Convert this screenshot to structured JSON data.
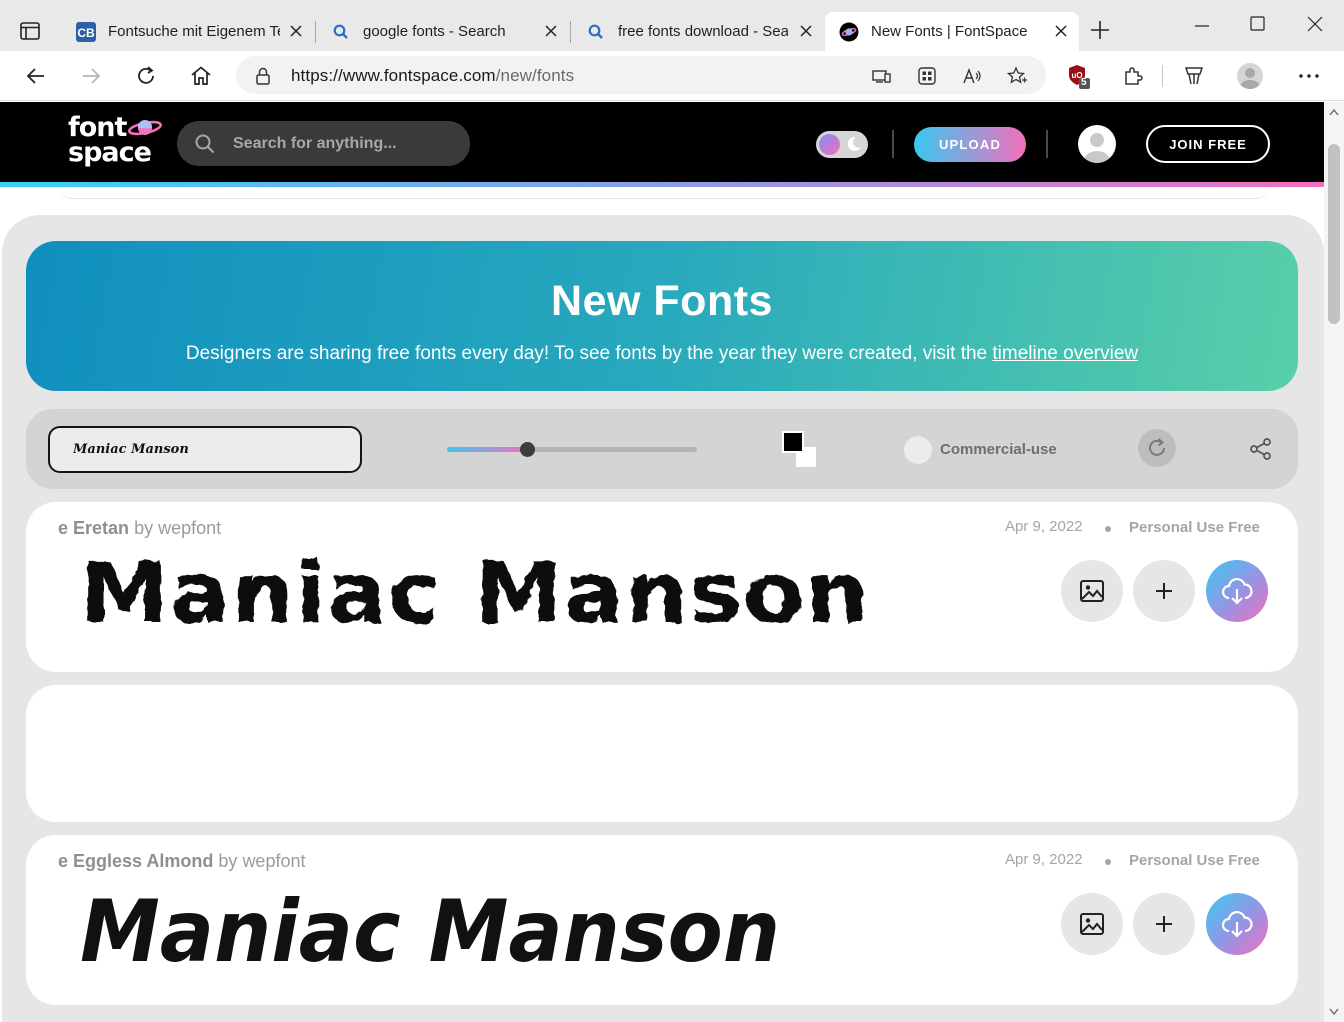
{
  "browser": {
    "tabs": [
      {
        "title": "Fontsuche mit Eigenem Te",
        "icon": "cb-favicon-icon",
        "active": false
      },
      {
        "title": "google fonts - Search",
        "icon": "search-favicon-icon",
        "active": false
      },
      {
        "title": "free fonts download - Sea",
        "icon": "search-favicon-icon",
        "active": false
      },
      {
        "title": "New Fonts | FontSpace",
        "icon": "fontspace-favicon-icon",
        "active": true
      }
    ],
    "url": {
      "domain": "https://www.fontspace.com",
      "path": "/new/fonts"
    },
    "extension_badge": "5"
  },
  "site": {
    "logo_line1": "font",
    "logo_line2": "space",
    "search_placeholder": "Search for anything...",
    "upload_label": "UPLOAD",
    "join_label": "JOIN FREE"
  },
  "hero": {
    "title": "New Fonts",
    "subtitle": "Designers are sharing free fonts every day! To see fonts by the year they were created, visit the",
    "link_text": "timeline overview"
  },
  "toolbar": {
    "preview_text": "Maniac Manson",
    "size_level": 0.32,
    "foreground_color": "#000000",
    "background_color": "#ffffff",
    "commercial_label": "Commercial-use"
  },
  "fonts": [
    {
      "prefix": "e",
      "name": "Eretan",
      "by": "by",
      "author": "wepfont",
      "date": "Apr 9, 2022",
      "license": "Personal Use Free",
      "preview": "Maniac Manson"
    },
    {
      "prefix": "e",
      "name": "Eggless Almond",
      "by": "by",
      "author": "wepfont",
      "date": "Apr 9, 2022",
      "license": "Personal Use Free",
      "preview": "Maniac Manson"
    }
  ],
  "colors": {
    "accent_cyan": "#3ad0f5",
    "accent_pink": "#f46ec0",
    "hero_start": "#108fbe",
    "hero_end": "#59cfa9"
  }
}
